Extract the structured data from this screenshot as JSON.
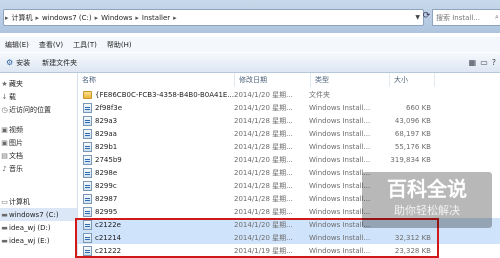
{
  "address": {
    "crumbs": [
      "计算机",
      "windows7 (C:)",
      "Windows",
      "Installer"
    ],
    "search_placeholder": "搜索 Install..."
  },
  "menu": [
    "编辑(E)",
    "查看(V)",
    "工具(T)",
    "帮助(H)"
  ],
  "toolbar": {
    "install_label": "安装",
    "new_folder_label": "新建文件夹"
  },
  "nav": {
    "items": [
      "藏夹",
      "载",
      "近访问的位置",
      "",
      "",
      "视频",
      "图片",
      "文档",
      "音乐",
      "",
      "计算机",
      "windows7 (C:)",
      "idea_wj (D:)",
      "idea_wj (E:)",
      ""
    ],
    "selected_index": 11
  },
  "columns": {
    "name": "名称",
    "date": "修改日期",
    "type": "类型",
    "size": "大小"
  },
  "files": [
    {
      "name": "{FE86CB0C-FCB3-4358-B4B0-B0A41E...",
      "date": "2014/1/20 星期...",
      "type": "文件夹",
      "size": "",
      "kind": "folder"
    },
    {
      "name": "2f98f3e",
      "date": "2014/1/20 星期...",
      "type": "Windows Install...",
      "size": "660 KB",
      "kind": "file"
    },
    {
      "name": "829a3",
      "date": "2014/1/28 星期...",
      "type": "Windows Install...",
      "size": "43,096 KB",
      "kind": "file"
    },
    {
      "name": "829aa",
      "date": "2014/1/28 星期...",
      "type": "Windows Install...",
      "size": "68,197 KB",
      "kind": "file"
    },
    {
      "name": "829b1",
      "date": "2014/1/28 星期...",
      "type": "Windows Install...",
      "size": "55,176 KB",
      "kind": "file"
    },
    {
      "name": "2745b9",
      "date": "2014/1/20 星期...",
      "type": "Windows Install...",
      "size": "319,834 KB",
      "kind": "file"
    },
    {
      "name": "8298e",
      "date": "2014/1/28 星期...",
      "type": "Windows Install...",
      "size": "",
      "kind": "file"
    },
    {
      "name": "8299c",
      "date": "2014/1/28 星期...",
      "type": "Windows Install...",
      "size": "",
      "kind": "file"
    },
    {
      "name": "82987",
      "date": "2014/1/28 星期...",
      "type": "Windows Install...",
      "size": "",
      "kind": "file"
    },
    {
      "name": "82995",
      "date": "2014/1/28 星期...",
      "type": "Windows Install...",
      "size": "",
      "kind": "file"
    },
    {
      "name": "c2122e",
      "date": "2014/1/20 星期...",
      "type": "Windows Install...",
      "size": "",
      "kind": "file"
    },
    {
      "name": "c21214",
      "date": "2014/1/20 星期...",
      "type": "Windows Install...",
      "size": "32,312 KB",
      "kind": "file"
    },
    {
      "name": "c21222",
      "date": "2014/1/19 星期...",
      "type": "Windows Install...",
      "size": "23,328 KB",
      "kind": "file"
    }
  ],
  "selected_rows": [
    10,
    11
  ],
  "watermark": {
    "title": "百科全说",
    "subtitle": "助你轻松解决"
  },
  "colors": {
    "highlight": "#d01a1a",
    "selection": "#cfe3fa"
  }
}
